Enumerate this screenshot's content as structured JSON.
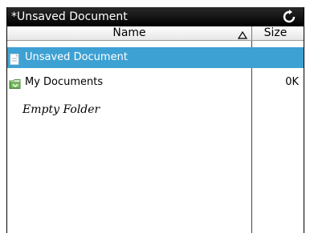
{
  "title_bar": {
    "title": "*Unsaved Document",
    "refresh_icon": "refresh-icon"
  },
  "columns": {
    "name": "Name",
    "size": "Size",
    "sort_icon": "sort-ascending-icon"
  },
  "rows": [
    {
      "name": "Unsaved Document",
      "size": "",
      "icon": "document-icon",
      "selected": true
    },
    {
      "name": "My Documents",
      "size": "0K",
      "icon": "folder-icon",
      "selected": false
    }
  ],
  "empty_text": "Empty Folder",
  "colors": {
    "title_bar": "#000000",
    "selection": "#3ea1d3",
    "folder": "#4a8f3a"
  }
}
